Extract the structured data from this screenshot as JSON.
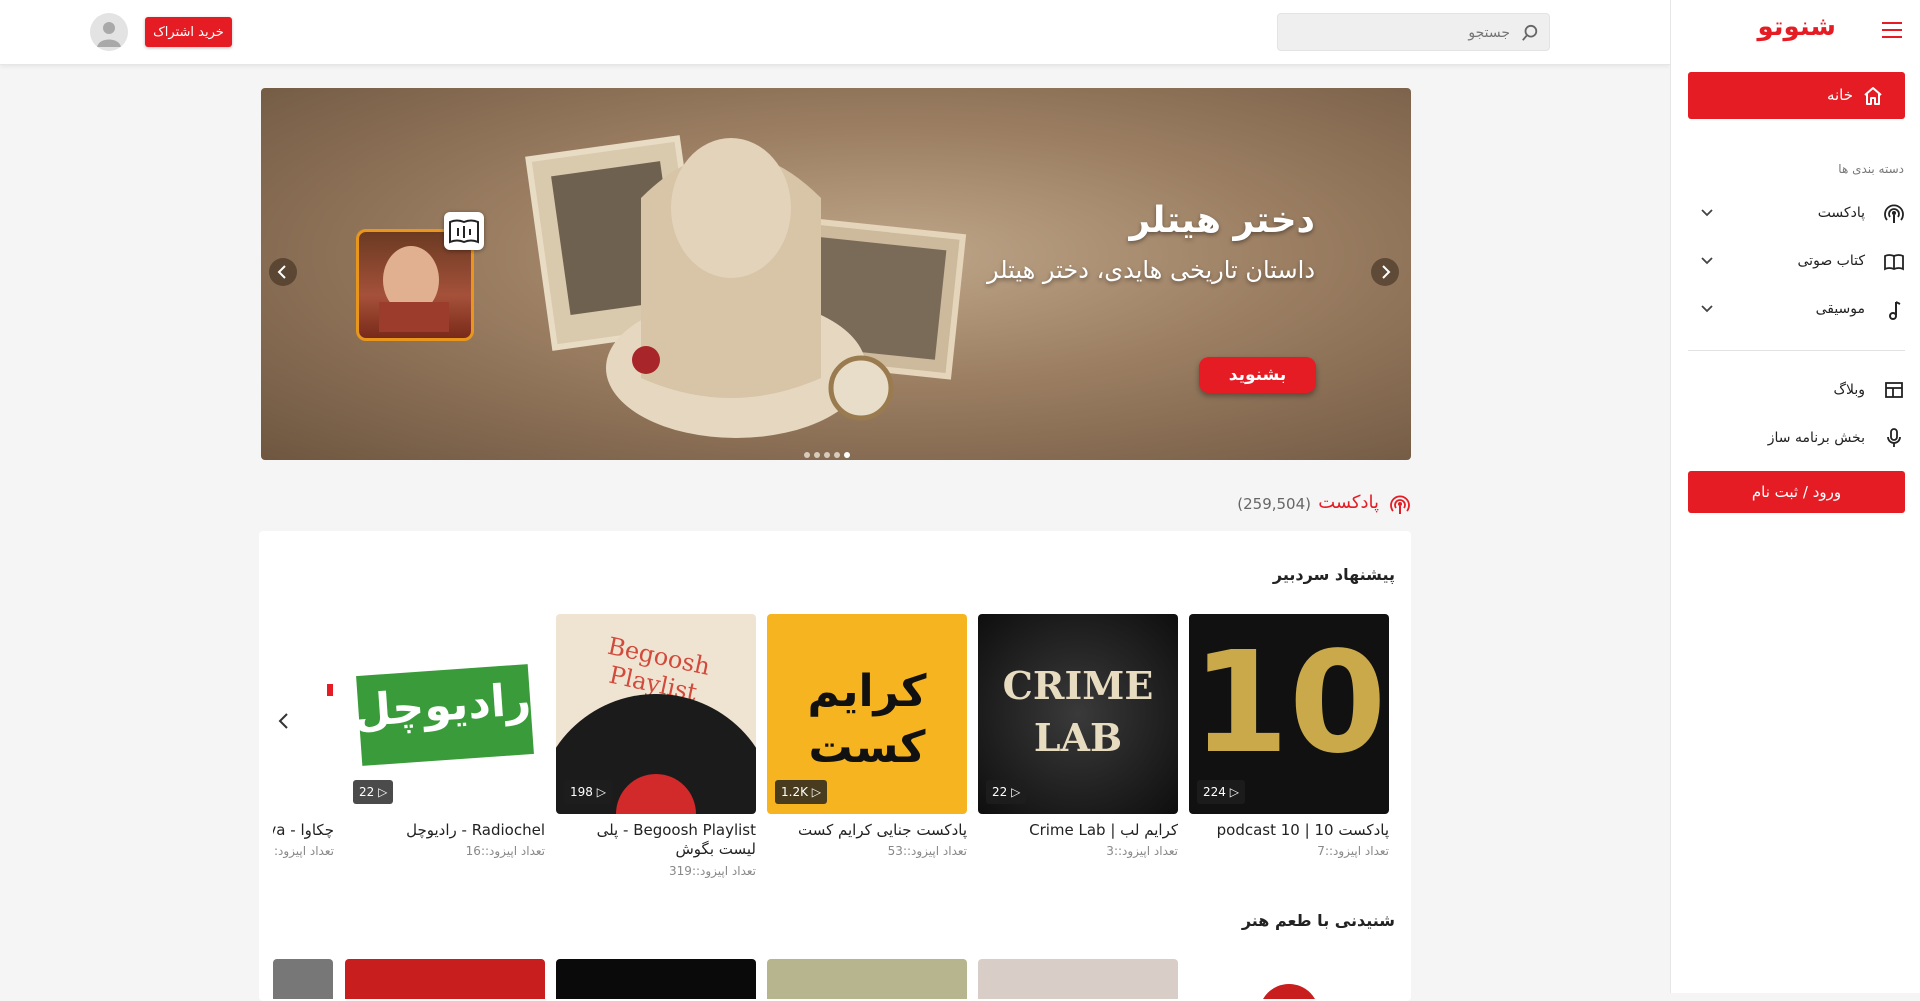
{
  "header": {
    "search_placeholder": "جستجو",
    "subscribe_label": "خرید اشتراک"
  },
  "sidebar": {
    "logo": "شنوتو",
    "home_label": "خانه",
    "categories_heading": "دسته بندی ها",
    "categories": [
      {
        "label": "پادکست",
        "icon": "podcast-icon"
      },
      {
        "label": "کتاب صوتی",
        "icon": "book-icon"
      },
      {
        "label": "موسیقی",
        "icon": "music-note-icon"
      }
    ],
    "links": [
      {
        "label": "وبلاگ",
        "icon": "blog-icon"
      },
      {
        "label": "بخش برنامه ساز",
        "icon": "microphone-icon"
      }
    ],
    "login_label": "ورود / ثبت نام"
  },
  "banner": {
    "title": "دختر هیتلر",
    "subtitle": "داستان تاریخی هایدی، دختر هیتلر",
    "cta_label": "بشنوید",
    "slide_count": 5,
    "active_slide": 5
  },
  "section": {
    "title": "پادکست",
    "count": "(259,504)",
    "rows": [
      {
        "title": "پیشنهاد سردبیر",
        "items": [
          {
            "title": "پادکست 10 | podcast 10",
            "meta": "تعداد اپیزود::7",
            "badge": "224",
            "cover_text": "10"
          },
          {
            "title": "کرایم لب | Crime Lab",
            "meta": "تعداد اپیزود::3",
            "badge": "22",
            "cover_text": "CRIME LAB"
          },
          {
            "title": "پادکست جنایی کرایم کست",
            "meta": "تعداد اپیزود::53",
            "badge": "1.2K",
            "cover_text": "کرایم کست"
          },
          {
            "title": "Begoosh Playlist - پلی لیست بگوش",
            "meta": "تعداد اپیزود::319",
            "badge": "198",
            "cover_text": "Begoosh Playlist"
          },
          {
            "title": "Radiochel - رادیوچل",
            "meta": "تعداد اپیزود::16",
            "badge": "22",
            "cover_text": "رادیوچل"
          },
          {
            "title": "چکاوا - va",
            "meta": "تعداد اپیزود:",
            "badge": "",
            "cover_text": ""
          }
        ]
      },
      {
        "title": "شنیدنی با طعم هنر"
      }
    ]
  },
  "colors": {
    "accent": "#e61c24",
    "background": "#f5f5f5"
  }
}
